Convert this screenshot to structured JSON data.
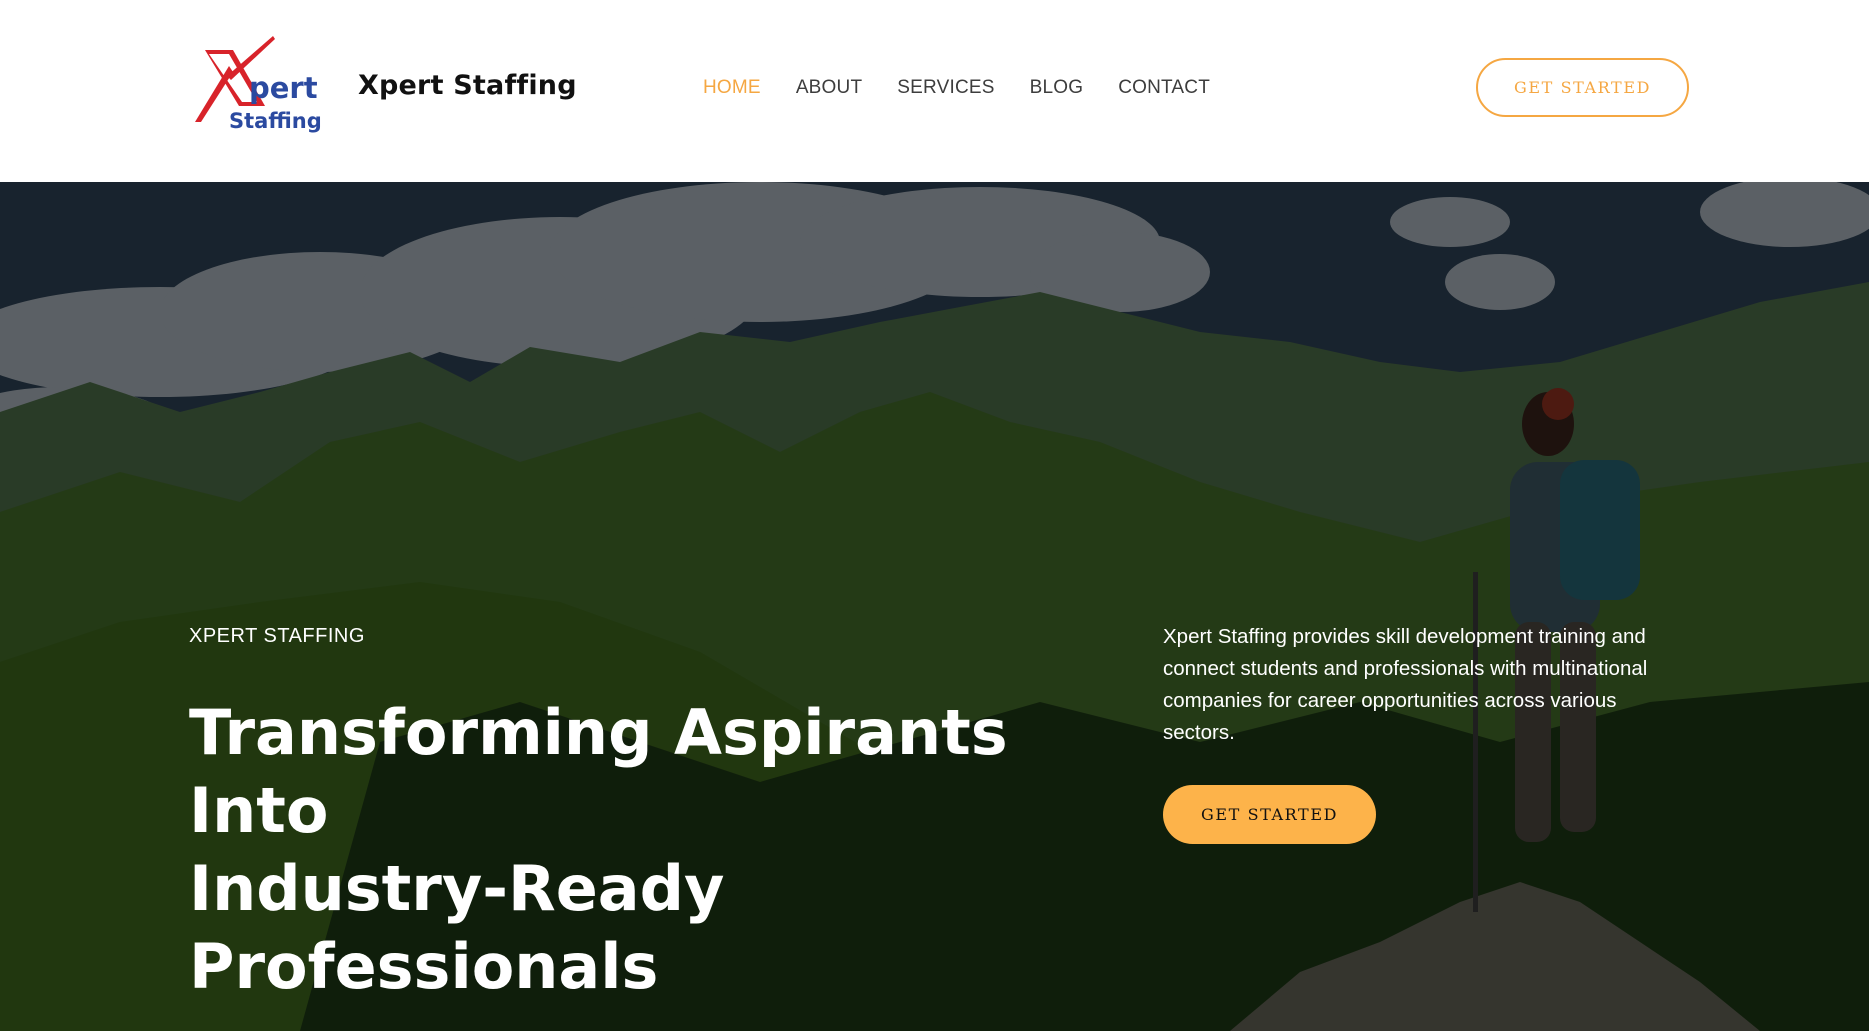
{
  "header": {
    "logo_text": "Xpert Staffing",
    "brand_name": "Xpert Staffing",
    "nav": [
      "HOME",
      "ABOUT",
      "SERVICES",
      "BLOG",
      "CONTACT"
    ],
    "active_nav": "HOME",
    "cta_label": "GET STARTED"
  },
  "hero": {
    "eyebrow": "XPERT STAFFING",
    "headline_lines": [
      "Transforming Aspirants Into",
      "Industry-Ready",
      "Professionals"
    ],
    "description": "Xpert Staffing provides skill development training and connect students and professionals with multinational companies for career opportunities across various sectors.",
    "cta_label": "GET STARTED",
    "background": "mountain-landscape-with-hiker"
  },
  "colors": {
    "accent": "#f5a742",
    "accent_fill": "#fdb34a",
    "logo_red": "#d8232a",
    "logo_blue": "#2b4aa0",
    "nav_text": "#3d3d3d"
  }
}
